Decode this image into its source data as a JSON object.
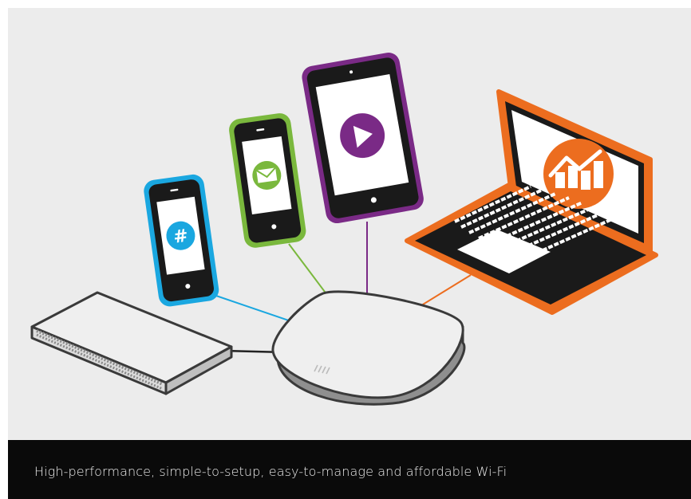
{
  "caption": {
    "text": "High-performance, simple-to-setup, easy-to-manage and affordable Wi-Fi"
  },
  "colors": {
    "background": "#ececec",
    "caption_bg": "#0a0a0a",
    "caption_text": "#ececec",
    "phone_blue": "#1aa7e0",
    "phone_green": "#7ab83d",
    "tablet_purple": "#7a2a86",
    "laptop_orange": "#ec6d1f",
    "device_dark": "#1a1a1a",
    "cable_gray": "#222222"
  },
  "devices": [
    {
      "name": "smartphone",
      "icon": "hashtag-icon",
      "accent": "#1aa7e0"
    },
    {
      "name": "smartphone",
      "icon": "envelope-icon",
      "accent": "#7ab83d"
    },
    {
      "name": "tablet",
      "icon": "play-icon",
      "accent": "#7a2a86"
    },
    {
      "name": "laptop",
      "icon": "chart-icon",
      "accent": "#ec6d1f"
    },
    {
      "name": "network-switch",
      "icon": "switch-icon",
      "accent": "#cccccc"
    },
    {
      "name": "wireless-access-point",
      "icon": "access-point-icon",
      "accent": "#dddddd"
    }
  ]
}
